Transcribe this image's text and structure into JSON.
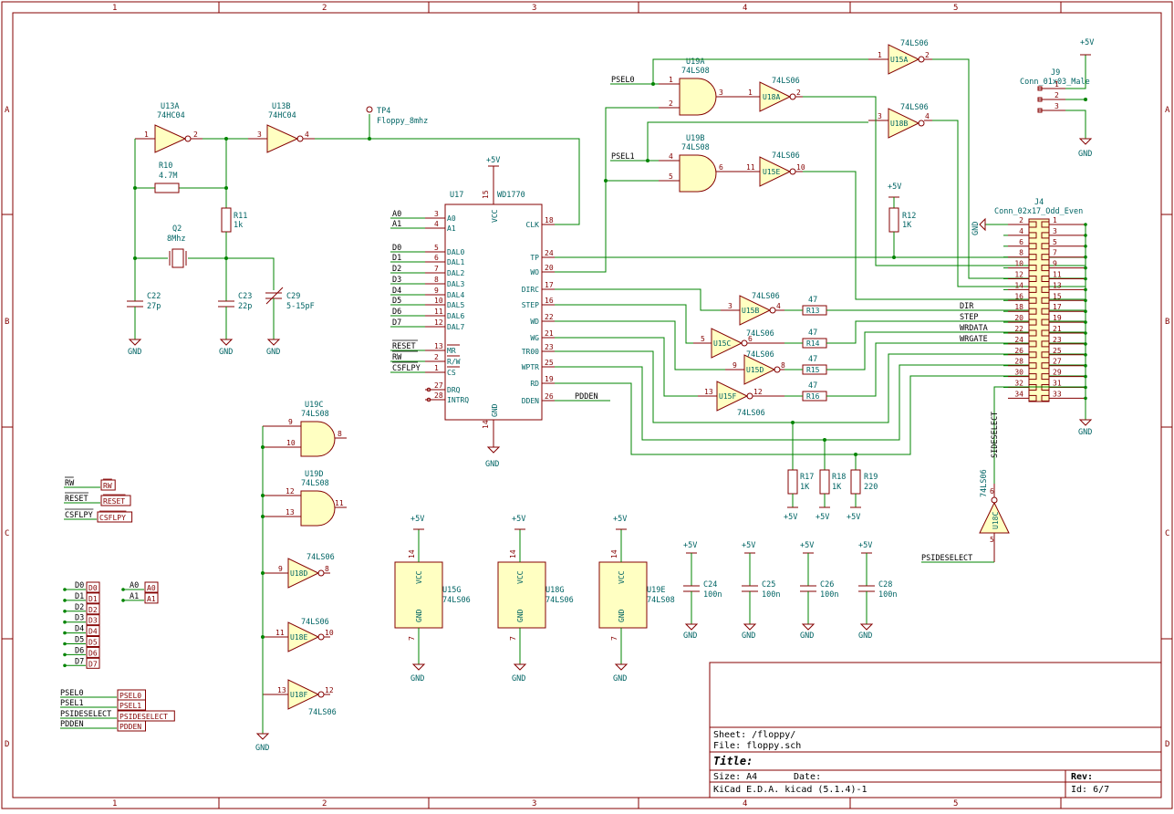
{
  "frame": {
    "columns": [
      "1",
      "2",
      "3",
      "4",
      "5"
    ],
    "rows": [
      "A",
      "B",
      "C",
      "D"
    ]
  },
  "title_block": {
    "sheet": "Sheet: /floppy/",
    "file": "File: floppy.sch",
    "title": "Title:",
    "size": "Size: A4",
    "date": "Date:",
    "rev": "Rev:",
    "tool": "KiCad E.D.A.  kicad (5.1.4)-1",
    "id": "Id: 6/7"
  },
  "components": {
    "u13a": {
      "ref": "U13A",
      "val": "74HC04",
      "p1": "1",
      "p2": "2"
    },
    "u13b": {
      "ref": "U13B",
      "val": "74HC04",
      "p1": "3",
      "p2": "4"
    },
    "tp4": {
      "ref": "TP4",
      "val": "Floppy_8mhz"
    },
    "r10": {
      "ref": "R10",
      "val": "4.7M"
    },
    "r11": {
      "ref": "R11",
      "val": "1k"
    },
    "q2": {
      "ref": "Q2",
      "val": "8Mhz"
    },
    "c22": {
      "ref": "C22",
      "val": "27p"
    },
    "c23": {
      "ref": "C23",
      "val": "22p"
    },
    "c29": {
      "ref": "C29",
      "val": "5-15pF"
    },
    "u17": {
      "ref": "U17",
      "val": "WD1770"
    },
    "u19a": {
      "ref": "U19A",
      "val": "74LS08",
      "p1": "1",
      "p2": "2",
      "p3": "3"
    },
    "u19b": {
      "ref": "U19B",
      "val": "74LS08",
      "p1": "4",
      "p2": "5",
      "p3": "6"
    },
    "u19c": {
      "ref": "U19C",
      "val": "74LS08",
      "p1": "9",
      "p2": "10",
      "p3": "8"
    },
    "u19d": {
      "ref": "U19D",
      "val": "74LS08",
      "p1": "12",
      "p2": "13",
      "p3": "11"
    },
    "u18a": {
      "ref": "U18A",
      "val": "74LS06",
      "p1": "1",
      "p2": "2"
    },
    "u15e": {
      "ref": "U15E",
      "val": "74LS06",
      "p1": "11",
      "p2": "10"
    },
    "u15a": {
      "ref": "U15A",
      "val": "74LS06",
      "p1": "1",
      "p2": "2"
    },
    "u18b": {
      "ref": "U18B",
      "val": "74LS06",
      "p1": "3",
      "p2": "4"
    },
    "u15b": {
      "ref": "U15B",
      "val": "74LS06",
      "p1": "3",
      "p2": "4"
    },
    "u15c": {
      "ref": "U15C",
      "val": "74LS06",
      "p1": "5",
      "p2": "6"
    },
    "u15d": {
      "ref": "U15D",
      "val": "74LS06",
      "p1": "9",
      "p2": "8"
    },
    "u15f": {
      "ref": "U15F",
      "val": "74LS06",
      "p1": "13",
      "p2": "12"
    },
    "u18c": {
      "ref": "U18C",
      "val": "74LS06",
      "p1": "5",
      "p2": "6"
    },
    "u18d": {
      "ref": "U18D",
      "val": "74LS06",
      "p1": "9",
      "p2": "8"
    },
    "u18e": {
      "ref": "U18E",
      "val": "74LS06",
      "p1": "11",
      "p2": "10"
    },
    "u18f": {
      "ref": "U18F",
      "val": "74LS06",
      "p1": "13",
      "p2": "12"
    },
    "u15g": {
      "ref": "U15G",
      "val": "74LS06"
    },
    "u18g": {
      "ref": "U18G",
      "val": "74LS06"
    },
    "u19e": {
      "ref": "U19E",
      "val": "74LS08"
    },
    "r13": {
      "ref": "R13",
      "val": "47"
    },
    "r14": {
      "ref": "R14",
      "val": "47"
    },
    "r15": {
      "ref": "R15",
      "val": "47"
    },
    "r16": {
      "ref": "R16",
      "val": "47"
    },
    "r12": {
      "ref": "R12",
      "val": "1K"
    },
    "r17": {
      "ref": "R17",
      "val": "1K"
    },
    "r18": {
      "ref": "R18",
      "val": "1K"
    },
    "r19": {
      "ref": "R19",
      "val": "220"
    },
    "c24": {
      "ref": "C24",
      "val": "100n"
    },
    "c25": {
      "ref": "C25",
      "val": "100n"
    },
    "c26": {
      "ref": "C26",
      "val": "100n"
    },
    "c28": {
      "ref": "C28",
      "val": "100n"
    },
    "j4": {
      "ref": "J4",
      "val": "Conn_02x17_Odd_Even"
    },
    "j9": {
      "ref": "J9",
      "val": "Conn_01x03_Male"
    }
  },
  "wd1770_left_pins": [
    {
      "num": "3",
      "name": "A0",
      "net": "A0"
    },
    {
      "num": "4",
      "name": "A1",
      "net": "A1"
    },
    {
      "num": "5",
      "name": "DAL0",
      "net": "D0"
    },
    {
      "num": "6",
      "name": "DAL1",
      "net": "D1"
    },
    {
      "num": "7",
      "name": "DAL2",
      "net": "D2"
    },
    {
      "num": "8",
      "name": "DAL3",
      "net": "D3"
    },
    {
      "num": "9",
      "name": "DAL4",
      "net": "D4"
    },
    {
      "num": "10",
      "name": "DAL5",
      "net": "D5"
    },
    {
      "num": "11",
      "name": "DAL6",
      "net": "D6"
    },
    {
      "num": "12",
      "name": "DAL7",
      "net": "D7"
    },
    {
      "num": "13",
      "name": "MR",
      "net": "RESET"
    },
    {
      "num": "2",
      "name": "R/W",
      "net": "RW"
    },
    {
      "num": "1",
      "name": "CS",
      "net": "CSFLPY"
    },
    {
      "num": "27",
      "name": "DRQ",
      "net": ""
    },
    {
      "num": "28",
      "name": "INTRQ",
      "net": ""
    }
  ],
  "wd1770_right_pins": [
    {
      "num": "18",
      "name": "CLK"
    },
    {
      "num": "24",
      "name": "TP"
    },
    {
      "num": "20",
      "name": "WO"
    },
    {
      "num": "17",
      "name": "DIRC"
    },
    {
      "num": "16",
      "name": "STEP"
    },
    {
      "num": "22",
      "name": "WD"
    },
    {
      "num": "21",
      "name": "WG"
    },
    {
      "num": "23",
      "name": "TR00"
    },
    {
      "num": "25",
      "name": "WPTR"
    },
    {
      "num": "19",
      "name": "RD"
    },
    {
      "num": "26",
      "name": "DDEN"
    }
  ],
  "wd1770_power": {
    "vcc_pin": "15",
    "vcc": "VCC",
    "gnd_pin": "14",
    "gnd": "GND"
  },
  "j4_left_pins": [
    "2",
    "4",
    "6",
    "8",
    "10",
    "12",
    "14",
    "16",
    "18",
    "20",
    "22",
    "24",
    "26",
    "28",
    "30",
    "32",
    "34"
  ],
  "j4_right_pins": [
    "1",
    "3",
    "5",
    "7",
    "9",
    "11",
    "13",
    "15",
    "17",
    "19",
    "21",
    "23",
    "25",
    "27",
    "29",
    "31",
    "33"
  ],
  "j9_pins": [
    "1",
    "2",
    "3"
  ],
  "nets": {
    "psel0": "PSEL0",
    "psel1": "PSEL1",
    "pddden": "PDDEN",
    "dir": "DIR",
    "step": "STEP",
    "wrdata": "WRDATA",
    "wrgate": "WRGATE",
    "sideselect": "SIDESELECT",
    "psideselect": "PSIDESELECT",
    "p5v": "+5V",
    "gnd": "GND"
  },
  "gate_pins": {
    "vcc_pin": "14",
    "gnd_pin": "7",
    "vcc": "VCC",
    "gnd": "GND"
  },
  "global_labels": {
    "bus_left": [
      {
        "net": "RW",
        "label": "RW"
      },
      {
        "net": "RESET",
        "label": "RESET"
      },
      {
        "net": "CSFLPY",
        "label": "CSFLPY"
      }
    ],
    "data": [
      "D0",
      "D1",
      "D2",
      "D3",
      "D4",
      "D5",
      "D6",
      "D7"
    ],
    "addr": [
      "A0",
      "A1"
    ],
    "psel": [
      {
        "net": "PSEL0",
        "label": "PSEL0"
      },
      {
        "net": "PSEL1",
        "label": "PSEL1"
      },
      {
        "net": "PSIDESELECT",
        "label": "PSIDESELECT"
      },
      {
        "net": "PDDEN",
        "label": "PDDEN"
      }
    ]
  }
}
